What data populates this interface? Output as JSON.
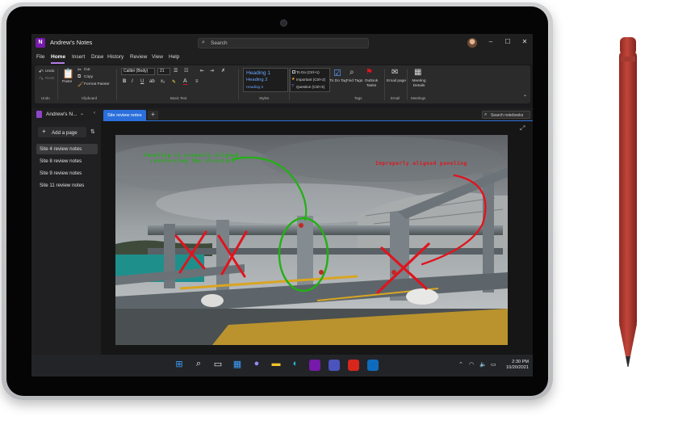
{
  "window": {
    "title": "Andrew's Notes",
    "search_placeholder": "Search"
  },
  "menu": [
    "File",
    "Home",
    "Insert",
    "Draw",
    "History",
    "Review",
    "View",
    "Help"
  ],
  "ribbon": {
    "undo": {
      "undo": "Undo",
      "redo": "Redo",
      "group": "Undo"
    },
    "clipboard": {
      "paste": "Paste",
      "cut": "Cut",
      "copy": "Copy",
      "format_painter": "Format Painter",
      "group": "Clipboard"
    },
    "basic_text": {
      "font": "Calibri (Body)",
      "size": "21",
      "bold": "B",
      "italic": "I",
      "underline": "U",
      "group": "Basic Text"
    },
    "styles": {
      "items": [
        "Heading 1",
        "Heading 2",
        "Heading 3"
      ],
      "group": "Styles"
    },
    "tags": {
      "items": [
        "To Do (Ctrl+1)",
        "Important (Ctrl+2)",
        "Question (Ctrl+3)"
      ],
      "todo_tag": "To Do Tag",
      "find_tags": "Find Tags",
      "outlook_tasks": "Outlook Tasks",
      "group": "Tags"
    },
    "email": {
      "label": "Email page",
      "group": "Email"
    },
    "meetings": {
      "label": "Meeting Details",
      "group": "Meetings"
    }
  },
  "notebook": {
    "name": "Andrew's N...",
    "active_section": "Site review notes",
    "add_section": "+",
    "search": "Search notebooks"
  },
  "pages": {
    "add_page": "Add a page",
    "items": [
      "Site 4 review notes",
      "Site 8 review notes",
      "Site 9 review notes",
      "Site 11 review notes"
    ],
    "selected_index": 0
  },
  "annotations": {
    "green": [
      "Paneling is properly aligned,",
      "reinforcing the structure"
    ],
    "red": "Improperly aligned paneling"
  },
  "taskbar": {
    "apps": [
      "start-icon",
      "search-icon",
      "task-view-icon",
      "widgets-icon",
      "teams-chat-icon",
      "file-explorer-icon",
      "edge-icon",
      "onenote-icon",
      "teams-icon",
      "acrobat-icon",
      "outlook-icon"
    ],
    "time": "2:30 PM",
    "date": "10/20/2021"
  },
  "colors": {
    "accent": "#2a6fdb",
    "onenote_purple": "#7719aa",
    "ink_green": "#22b014",
    "ink_red": "#e0141e",
    "pen_red": "#b5352c"
  }
}
